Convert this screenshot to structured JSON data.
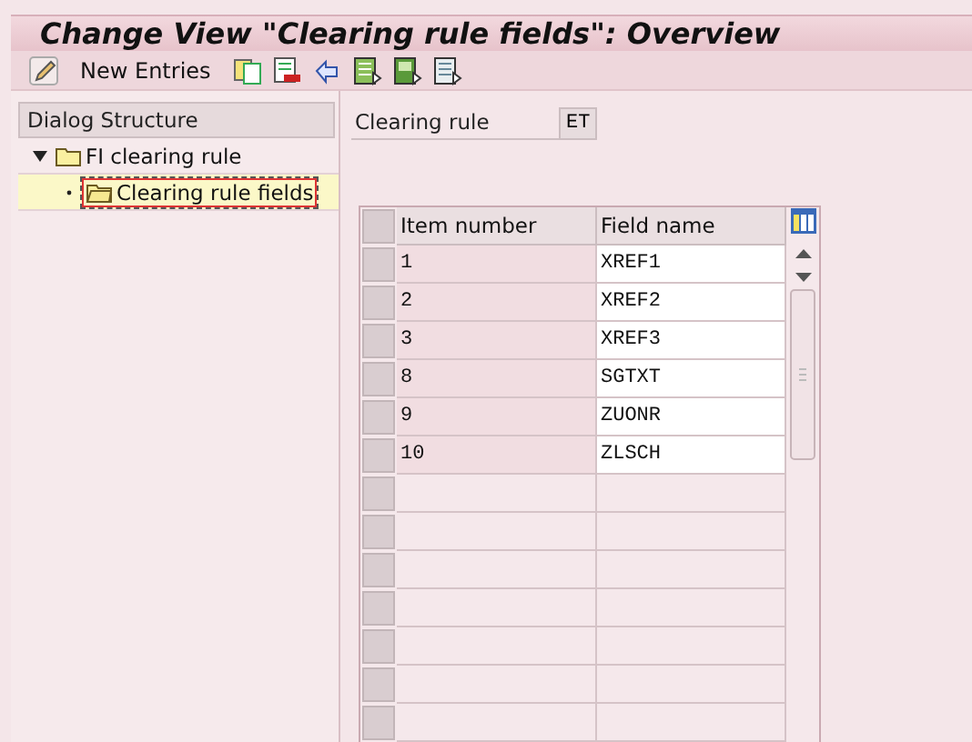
{
  "window": {
    "title": "Change View \"Clearing rule fields\": Overview"
  },
  "toolbar": {
    "new_entries": "New Entries"
  },
  "dialog_structure": {
    "title": "Dialog Structure",
    "items": [
      {
        "label": "FI clearing rule",
        "selected": false,
        "expanded": true,
        "children": [
          {
            "label": "Clearing rule fields",
            "selected": true
          }
        ]
      }
    ]
  },
  "header_field": {
    "label": "Clearing rule",
    "value": "ET"
  },
  "table": {
    "columns": [
      "Item number",
      "Field name"
    ],
    "rows": [
      {
        "item_number": "1",
        "field_name": "XREF1"
      },
      {
        "item_number": "2",
        "field_name": "XREF2"
      },
      {
        "item_number": "3",
        "field_name": "XREF3"
      },
      {
        "item_number": "8",
        "field_name": "SGTXT"
      },
      {
        "item_number": "9",
        "field_name": "ZUONR"
      },
      {
        "item_number": "10",
        "field_name": "ZLSCH"
      }
    ]
  }
}
